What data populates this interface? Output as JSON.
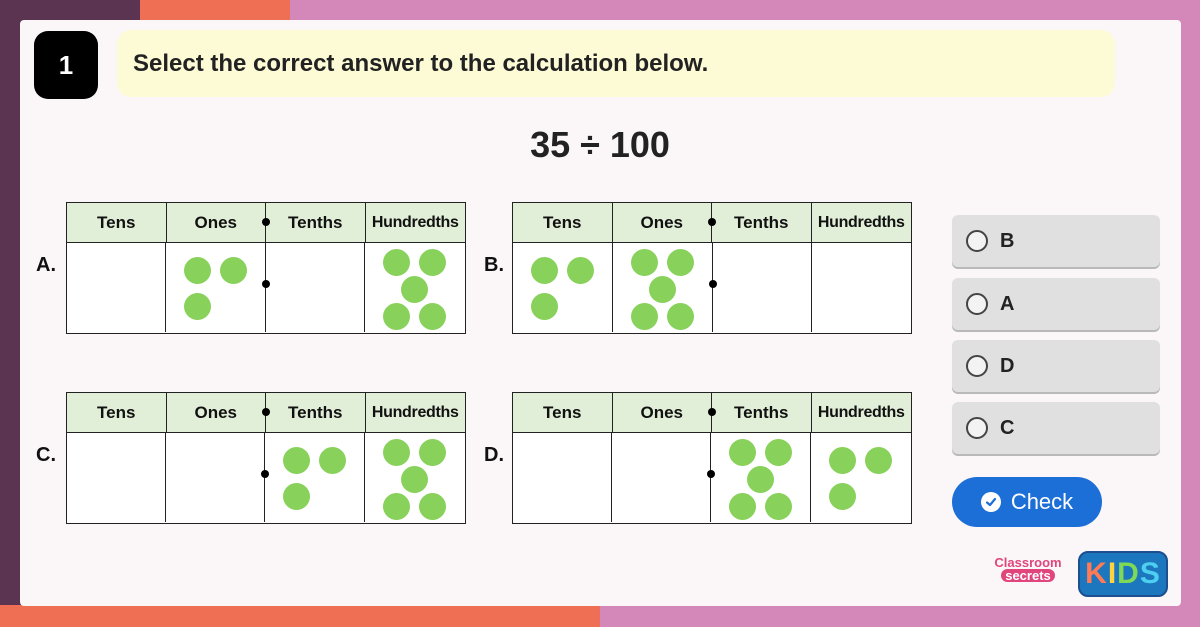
{
  "question": {
    "number": "1",
    "prompt": "Select the correct answer to the calculation below.",
    "calculation": "35 ÷ 100"
  },
  "headers": [
    "Tens",
    "Ones",
    "Tenths",
    "Hundredths"
  ],
  "options": [
    {
      "label": "A.",
      "counters": [
        0,
        3,
        0,
        5
      ]
    },
    {
      "label": "B.",
      "counters": [
        3,
        5,
        0,
        0
      ]
    },
    {
      "label": "C.",
      "counters": [
        0,
        0,
        3,
        5
      ]
    },
    {
      "label": "D.",
      "counters": [
        0,
        0,
        5,
        3
      ]
    }
  ],
  "answers": [
    {
      "label": "B"
    },
    {
      "label": "A"
    },
    {
      "label": "D"
    },
    {
      "label": "C"
    }
  ],
  "check_label": "Check",
  "logo": {
    "classroom": "Classroom",
    "secrets": "secrets",
    "kids": [
      "K",
      "I",
      "D",
      "S"
    ]
  },
  "colors": {
    "counter": "#88d15a",
    "header_fill": "#e2efd8",
    "check_button": "#1b6fd6",
    "question_bg": "#fdfbd5"
  }
}
